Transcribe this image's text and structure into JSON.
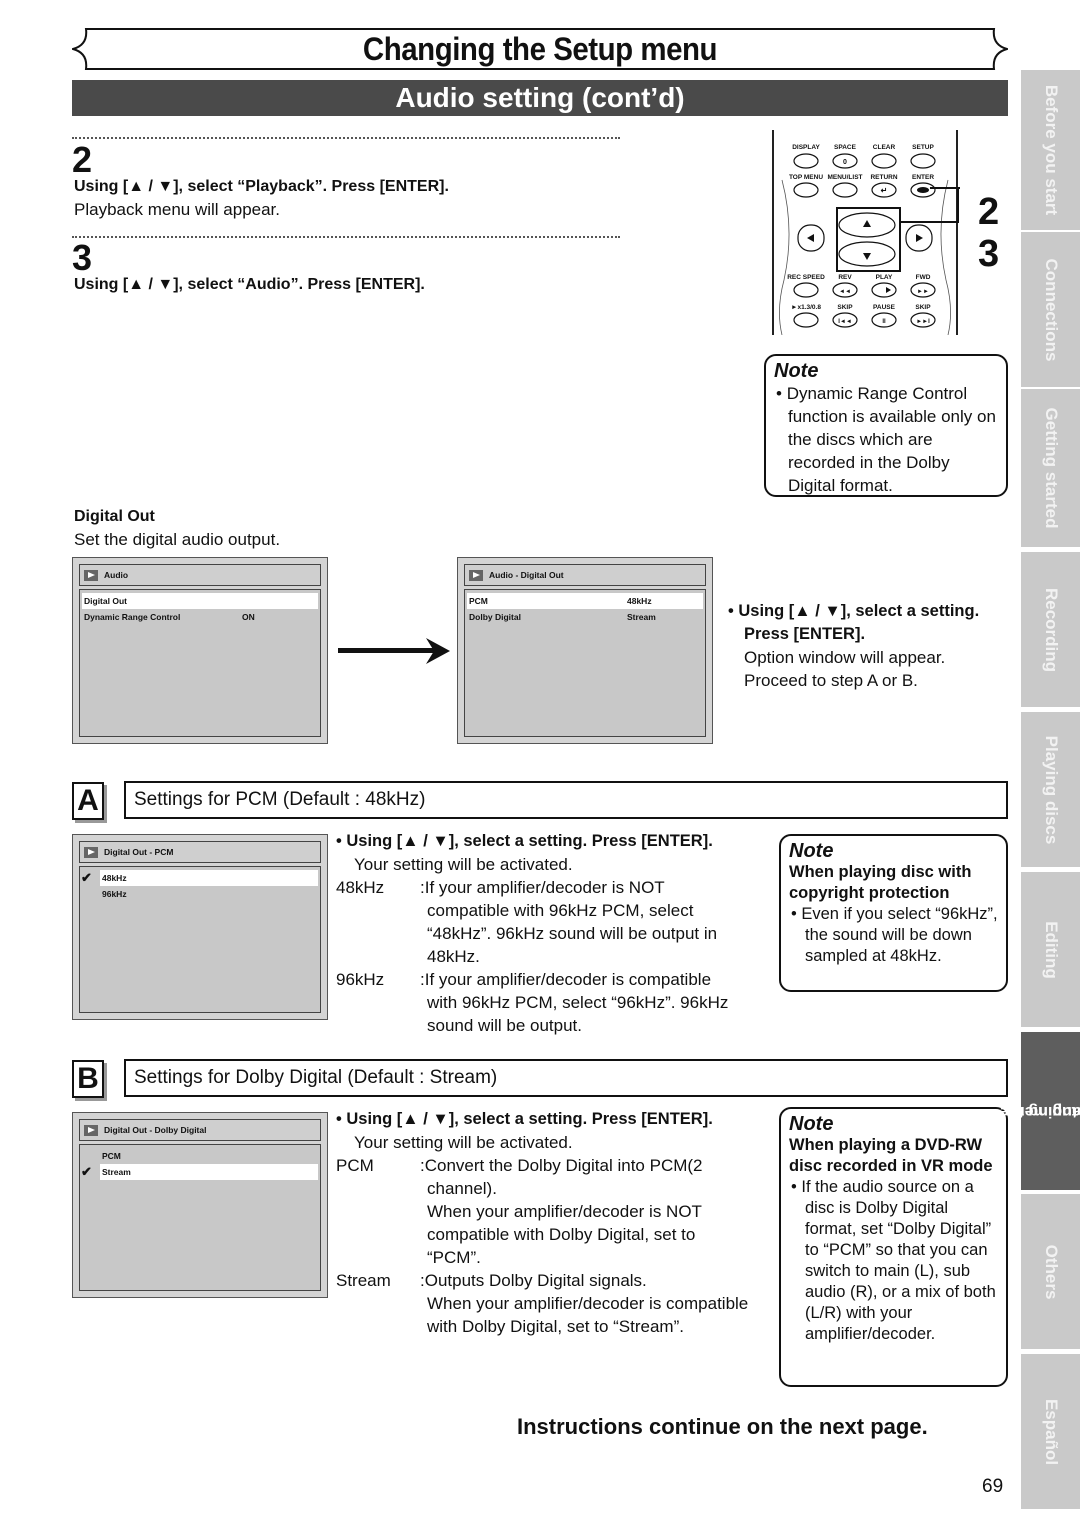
{
  "header": {
    "title": "Changing the Setup menu",
    "subtitle": "Audio setting (cont’d)"
  },
  "steps": [
    {
      "number": "2",
      "instruction": "Using [▲ / ▼], select “Playback”. Press [ENTER].",
      "result": "Playback menu will appear."
    },
    {
      "number": "3",
      "instruction": "Using [▲ / ▼], select “Audio”. Press [ENTER].",
      "result": ""
    }
  ],
  "remote": {
    "step_labels": [
      "2",
      "3"
    ],
    "rows": [
      [
        "DISPLAY",
        "SPACE",
        "CLEAR",
        "SETUP"
      ],
      [
        "TOP MENU",
        "MENU/LIST",
        "RETURN",
        "ENTER"
      ],
      [
        "REC SPEED",
        "REV",
        "PLAY",
        "FWD"
      ],
      [
        "►x1.3/0.8",
        "SKIP",
        "PAUSE",
        "SKIP"
      ]
    ],
    "space_key_glyph": "0"
  },
  "note1": {
    "title": "Note",
    "bullet": "Dynamic Range Control function is available only on the discs which are recorded in the Dolby Digital format."
  },
  "digital_out": {
    "heading": "Digital Out",
    "description": "Set the digital audio output."
  },
  "osd_audio": {
    "title": "Audio",
    "rows": [
      {
        "label": "Digital Out",
        "value": "",
        "selected": true
      },
      {
        "label": "Dynamic Range Control",
        "value": "ON",
        "selected": false
      }
    ]
  },
  "osd_digital_out": {
    "title": "Audio - Digital Out",
    "rows": [
      {
        "label": "PCM",
        "value": "48kHz",
        "selected": true
      },
      {
        "label": "Dolby Digital",
        "value": "Stream",
        "selected": false
      }
    ]
  },
  "select_setting": {
    "instruction": "Using [▲ / ▼], select a setting. Press [ENTER].",
    "result_lines": [
      "Option window will appear.",
      "Proceed to step A or B."
    ]
  },
  "section_a": {
    "letter": "A",
    "title": "Settings for PCM (Default : 48kHz)",
    "osd": {
      "title": "Digital Out - PCM",
      "options": [
        {
          "label": "48kHz",
          "checked": true,
          "selected": true
        },
        {
          "label": "96kHz",
          "checked": false,
          "selected": false
        }
      ]
    },
    "instruction": "Using [▲ / ▼], select a setting. Press [ENTER].",
    "result": "Your setting will be activated.",
    "definitions": [
      {
        "term": "48kHz",
        "lines": [
          ":If your amplifier/decoder is NOT",
          "compatible with 96kHz PCM, select",
          "“48kHz”. 96kHz sound will be output in",
          "48kHz."
        ]
      },
      {
        "term": "96kHz",
        "lines": [
          ":If your amplifier/decoder is compatible",
          "with 96kHz PCM, select “96kHz”. 96kHz",
          "sound will be output."
        ]
      }
    ],
    "note": {
      "title": "Note",
      "heading": "When playing disc with copyright protection",
      "bullet": "Even if you select “96kHz”, the sound will be down sampled at 48kHz."
    }
  },
  "section_b": {
    "letter": "B",
    "title": "Settings for Dolby Digital (Default : Stream)",
    "osd": {
      "title": "Digital Out - Dolby Digital",
      "options": [
        {
          "label": "PCM",
          "checked": false,
          "selected": false
        },
        {
          "label": "Stream",
          "checked": true,
          "selected": true
        }
      ]
    },
    "instruction": "Using [▲ / ▼], select a setting. Press [ENTER].",
    "result": "Your setting will be activated.",
    "definitions": [
      {
        "term": "PCM",
        "lines": [
          ":Convert the Dolby Digital into PCM(2",
          "channel).",
          "When your amplifier/decoder is NOT",
          "compatible with Dolby Digital, set to",
          "“PCM”."
        ]
      },
      {
        "term": "Stream",
        "lines": [
          ":Outputs Dolby Digital signals.",
          "When your amplifier/decoder is compatible",
          "with Dolby Digital, set to “Stream”."
        ]
      }
    ],
    "note": {
      "title": "Note",
      "heading": "When playing a DVD-RW disc recorded in VR mode",
      "bullet": "If the audio source on a disc is Dolby Digital format, set “Dolby Digital” to “PCM” so that you can switch to main (L), sub audio (R), or a mix of both (L/R) with your amplifier/decoder."
    }
  },
  "footer": {
    "continue": "Instructions continue on the next page.",
    "page_number": "69"
  },
  "side_tabs": [
    {
      "label": "Before you start",
      "active": false
    },
    {
      "label": "Connections",
      "active": false
    },
    {
      "label": "Getting started",
      "active": false
    },
    {
      "label": "Recording",
      "active": false
    },
    {
      "label": "Playing discs",
      "active": false
    },
    {
      "label": "Editing",
      "active": false
    },
    {
      "label": "Changing the Setup menu",
      "line1": "Changing the",
      "line2": "Setup menu",
      "active": true
    },
    {
      "label": "Others",
      "active": false
    },
    {
      "label": "Español",
      "active": false
    }
  ],
  "colors": {
    "subtitle_bar": "#4a4a4a",
    "tab_inactive": "#c9c9c9",
    "tab_active": "#5e5e5e",
    "osd_background": "#d4d4d4"
  }
}
